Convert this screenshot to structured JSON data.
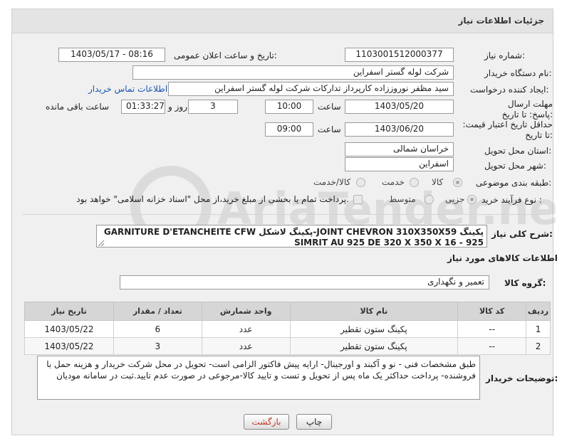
{
  "header": {
    "title": "جزئیات اطلاعات نیاز"
  },
  "fields": {
    "need_number_label": "شماره نیاز:",
    "need_number": "1103001512000377",
    "announce_label": "تاریخ و ساعت اعلان عمومی:",
    "announce_value": "1403/05/17 - 08:16",
    "buyer_label": "نام دستگاه خریدار:",
    "buyer_value": "شرکت لوله گستر اسفراین",
    "creator_label": "ایجاد کننده درخواست:",
    "creator_value": "سید مظفر نوروززاده کارپرداز تدارکات شرکت لوله گستر اسفراین",
    "contact_link": "اطلاعات تماس خریدار",
    "deadline_label": "مهلت ارسال پاسخ: تا تاریخ:",
    "deadline_date": "1403/05/20",
    "time_label": "ساعت",
    "deadline_time": "10:00",
    "days_value": "3",
    "days_label": "روز و",
    "remaining_value": "01:33:27",
    "remaining_label": "ساعت باقی مانده",
    "validity_label": "حداقل تاریخ اعتبار قیمت: تا تاریخ:",
    "validity_date": "1403/06/20",
    "validity_time_label": "ساعت",
    "validity_time": "09:00",
    "province_label": "استان محل تحویل:",
    "province_value": "خراسان شمالی",
    "city_label": "شهر محل تحویل:",
    "city_value": "اسفراین",
    "category_label": "طبقه بندی موضوعی:",
    "category_options": [
      "کالا",
      "خدمت",
      "کالا/خدمت"
    ],
    "process_label": "نوع فرآیند خرید :",
    "process_options": [
      "جزیی",
      "متوسط"
    ],
    "payment_note": "پرداخت تمام یا بخشی از مبلغ خرید،از محل \"اسناد خزانه اسلامی\" خواهد بود."
  },
  "summary": {
    "label": "شرح کلی نیاز:",
    "text": "پکینگ JOINT CHEVRON 310X350X59-پکینگ لاشکل GARNITURE D'ETANCHEITE CFW SIMRIT AU 925 DE 320 X 350 X 16 - 925"
  },
  "goods_section_title": "اطلاعات کالاهای مورد نیاز",
  "goods_group": {
    "label": "گروه کالا:",
    "value": "تعمیر و نگهداری"
  },
  "table": {
    "headers": [
      "ردیف",
      "کد کالا",
      "نام کالا",
      "واحد شمارش",
      "تعداد / مقدار",
      "تاریخ نیاز"
    ],
    "rows": [
      [
        "1",
        "--",
        "پکینگ ستون تقطیر",
        "عدد",
        "6",
        "1403/05/22"
      ],
      [
        "2",
        "--",
        "پکینگ ستون تقطیر",
        "عدد",
        "3",
        "1403/05/22"
      ]
    ]
  },
  "notes": {
    "label": "توضیحات خریدار:",
    "text": "طبق مشخصات فنی - نو و آکبند و اورجینال- ارایه پیش فاکتور الزامی است- تحویل در محل شرکت خریدار و هزینه حمل با فروشنده- پرداخت حداکثر یک ماه پس از تحویل و تست و تایید کالا-مرجوعی در صورت عدم تایید.ثبت در سامانه مودیان"
  },
  "buttons": {
    "print": "چاپ",
    "back": "بازگشت"
  },
  "watermark_text": "AriaTender.neT",
  "colors": {
    "link": "#1a56b3",
    "back_button_text": "#c0392b"
  }
}
